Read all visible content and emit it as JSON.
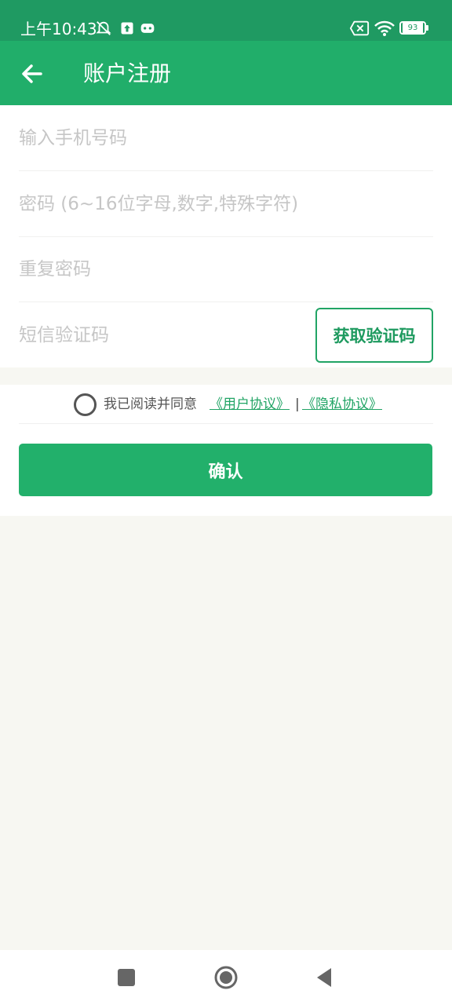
{
  "status_bar": {
    "time": "上午10:43",
    "battery": "93",
    "icons": [
      "notification-muted-icon",
      "upload-icon",
      "gamepad-icon",
      "sim-disabled-icon",
      "wifi-icon",
      "battery-icon"
    ]
  },
  "header": {
    "title": "账户注册",
    "back_icon": "arrow-left-icon"
  },
  "form": {
    "phone_placeholder": "输入手机号码",
    "password_placeholder": "密码 (6~16位字母,数字,特殊字符)",
    "repeat_password_placeholder": "重复密码",
    "sms_code_placeholder": "短信验证码",
    "get_code_label": "获取验证码"
  },
  "agreement": {
    "text": "我已阅读并同意",
    "user_agreement_link": "《用户协议》",
    "separator": "|",
    "privacy_link": "《隐私协议》",
    "checked": false
  },
  "actions": {
    "confirm_label": "确认"
  },
  "colors": {
    "status_bar": "#1f9a62",
    "header": "#21ae6a",
    "primary": "#22b06b",
    "background": "#f7f7f2"
  },
  "navigation": {
    "icons": [
      "recent-apps-icon",
      "home-icon",
      "back-nav-icon"
    ]
  }
}
